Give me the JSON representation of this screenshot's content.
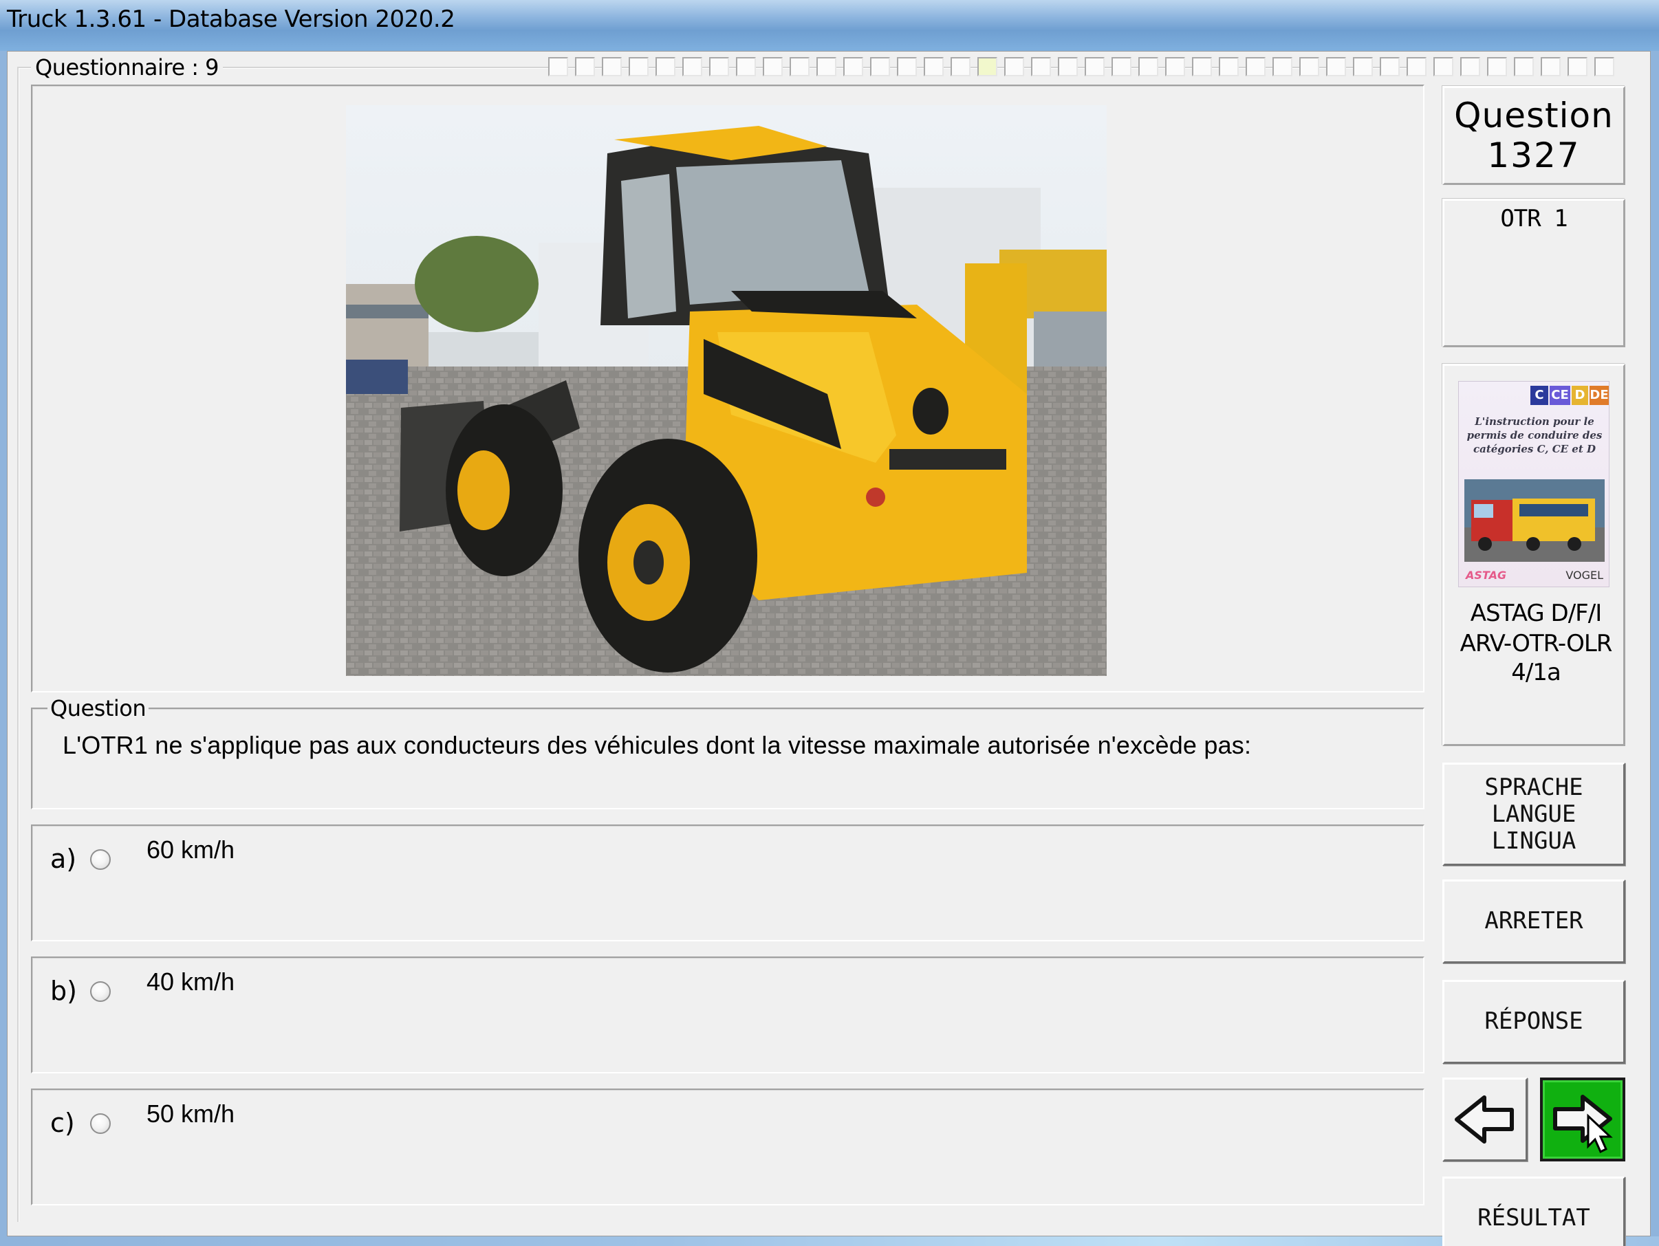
{
  "window": {
    "title": "Truck 1.3.61 - Database Version 2020.2"
  },
  "questionnaire": {
    "label": "Questionnaire : 9",
    "progress_total": 40,
    "progress_current": 16
  },
  "question_box": {
    "label": "Question",
    "text": "L'OTR1 ne s'applique pas aux conducteurs des véhicules dont la vitesse maximale autorisée n'excède pas:"
  },
  "answers": [
    {
      "letter": "a)",
      "text": "60 km/h",
      "selected": false
    },
    {
      "letter": "b)",
      "text": "40 km/h",
      "selected": false
    },
    {
      "letter": "c)",
      "text": "50 km/h",
      "selected": false
    }
  ],
  "sidebar": {
    "question_label": "Question",
    "question_number": "1327",
    "category": "OTR 1",
    "book": {
      "badges": [
        "C",
        "CE",
        "D",
        "DE"
      ],
      "blurb": "L'instruction pour le permis de conduire des catégories C, CE et D",
      "publisher_left": "ASTAG",
      "publisher_right": "VOGEL",
      "title_line1": "ASTAG D/F/I",
      "title_line2": "ARV-OTR-OLR",
      "title_line3": "4/1a"
    },
    "lang_button": [
      "SPRACHE",
      "LANGUE",
      "LINGUA"
    ],
    "stop_button": "ARRETER",
    "answer_button": "RÉPONSE",
    "result_button": "RÉSULTAT",
    "prev_icon": "arrow-left-icon",
    "next_icon": "arrow-right-icon"
  },
  "colors": {
    "next_button": "#10b010",
    "photo_vehicle": "#f2b616"
  }
}
